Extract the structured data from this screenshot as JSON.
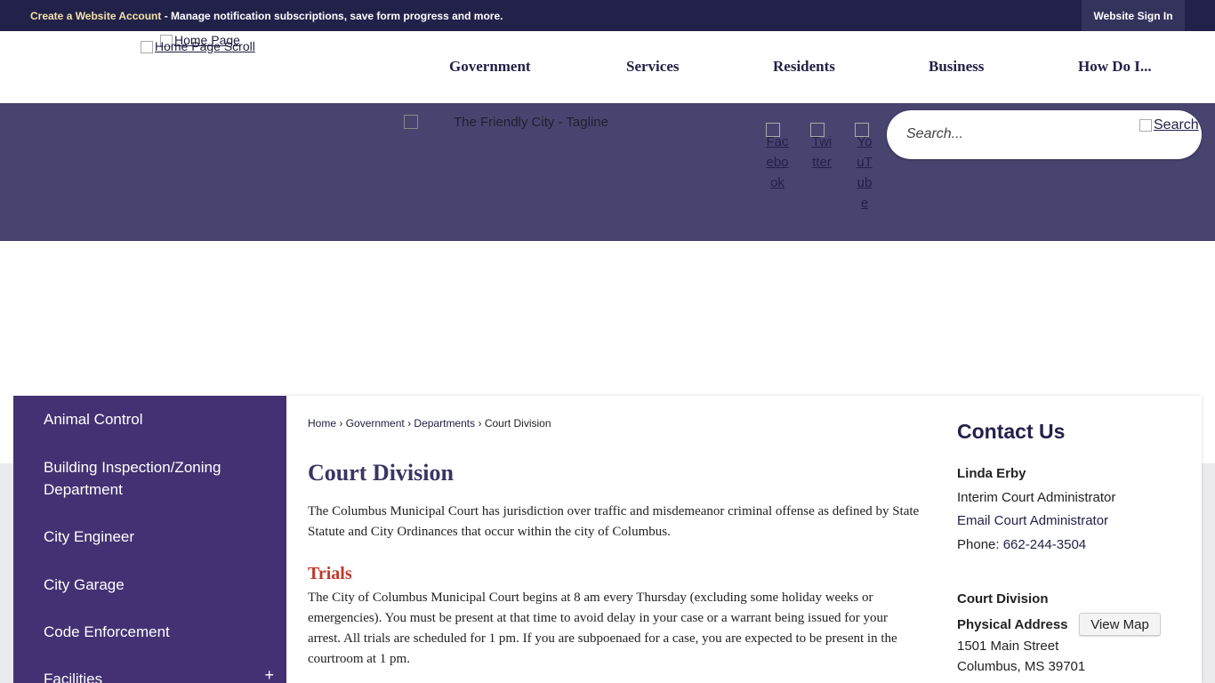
{
  "topbar": {
    "account_link": "Create a Website Account",
    "account_desc": " - Manage notification subscriptions, save form progress and more.",
    "signin": "Website Sign In"
  },
  "header": {
    "logo_alt_1": "Home Page",
    "logo_alt_2": "Home Page Scroll",
    "nav": [
      "Government",
      "Services",
      "Residents",
      "Business",
      "How Do I..."
    ]
  },
  "banner": {
    "tagline": "The Friendly City - Tagline",
    "social": [
      "Facebook",
      "Twitter",
      "YouTube"
    ],
    "search_placeholder": "Search...",
    "search_button": "Search"
  },
  "sidebar": {
    "items": [
      "Animal Control",
      "Building Inspection/Zoning Department",
      "City Engineer",
      "City Garage",
      "Code Enforcement",
      "Facilities"
    ],
    "expand_symbol": "+"
  },
  "breadcrumb": {
    "links": [
      "Home",
      "Government",
      "Departments"
    ],
    "separator": "›",
    "current": "Court Division"
  },
  "main": {
    "title": "Court Division",
    "intro": "The Columbus Municipal Court has jurisdiction over traffic and misdemeanor criminal offense as defined by State Statute and City Ordinances that occur within the city of Columbus.",
    "trials_heading": "Trials",
    "trials_text": "The City of Columbus Municipal Court begins at 8 am every Thursday (excluding some holiday weeks or emergencies). You must be present at that time to avoid delay in your case or a warrant being issued for your arrest. All trials are scheduled for 1 pm. If you are subpoenaed for a case, you are expected to be present in the courtroom at 1 pm."
  },
  "contact": {
    "heading": "Contact Us",
    "name": "Linda Erby",
    "role": "Interim Court Administrator",
    "email_link": "Email Court Administrator",
    "phone_label": "Phone: ",
    "phone": "662-244-3504",
    "dept": "Court Division",
    "address_label": "Physical Address",
    "view_map": "View Map",
    "street": "1501 Main Street",
    "city": "Columbus, MS 39701"
  },
  "colors": {
    "topbar": "#22214a",
    "banner": "#47456f",
    "sidebar": "#443173",
    "title": "#3a3564",
    "trials_heading": "#c0392b"
  }
}
